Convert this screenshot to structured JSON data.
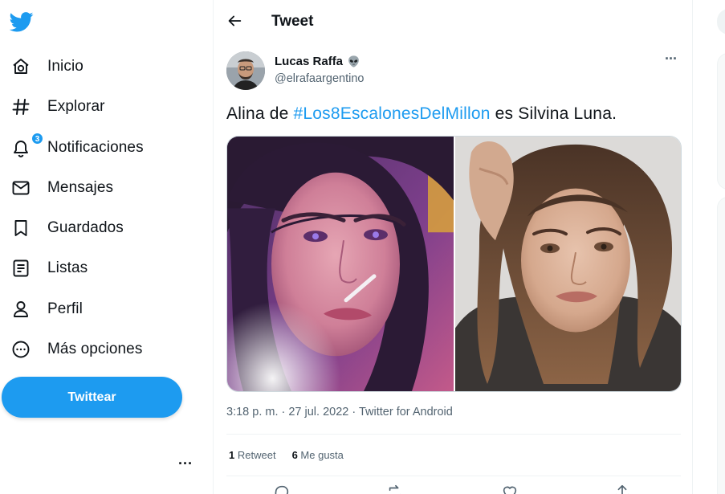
{
  "nav": {
    "items": [
      {
        "label": "Inicio",
        "icon": "home-icon"
      },
      {
        "label": "Explorar",
        "icon": "hashtag-icon"
      },
      {
        "label": "Notificaciones",
        "icon": "bell-icon"
      },
      {
        "label": "Mensajes",
        "icon": "envelope-icon"
      },
      {
        "label": "Guardados",
        "icon": "bookmark-icon"
      },
      {
        "label": "Listas",
        "icon": "list-icon"
      },
      {
        "label": "Perfil",
        "icon": "person-icon"
      },
      {
        "label": "Más opciones",
        "icon": "more-circle-icon"
      }
    ],
    "notifications_badge": "3",
    "tweet_button": "Twittear",
    "more_menu": "···"
  },
  "header": {
    "title": "Tweet"
  },
  "tweet": {
    "author_name": "Lucas Raffa",
    "author_handle": "@elrafaargentino",
    "text_before": "Alina de ",
    "hashtag": "#Los8EscalonesDelMillon",
    "text_after": " es Silvina Luna.",
    "more": "···",
    "meta": "3:18 p. m. · 27 jul. 2022 · Twitter for Android",
    "retweets": {
      "count": "1",
      "label": "Retweet"
    },
    "likes": {
      "count": "6",
      "label": "Me gusta"
    }
  },
  "colors": {
    "accent": "#1d9bf0",
    "text": "#0f1419",
    "muted": "#536471",
    "border": "#eff3f4"
  }
}
